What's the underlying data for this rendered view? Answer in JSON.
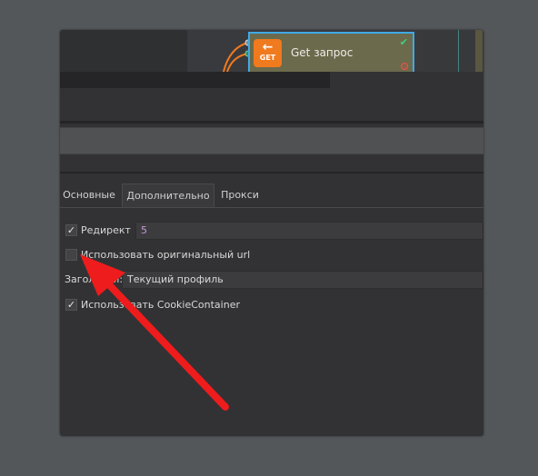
{
  "node": {
    "icon_label": "GET",
    "icon_arrow": "←",
    "title": "Get запрос",
    "status_check": "✔"
  },
  "tabs": [
    {
      "label": "Основные"
    },
    {
      "label": "Дополнительно",
      "active": true
    },
    {
      "label": "Прокси"
    }
  ],
  "settings": {
    "redirect": {
      "label": "Редирект",
      "checked": true,
      "check_glyph": "✓",
      "value": "5"
    },
    "original_url": {
      "label": "Использовать оригинальный url",
      "checked": false
    },
    "headers": {
      "label": "Заголовки:",
      "value": "Текущий профиль"
    },
    "cookie_container": {
      "label": "Использовать CookieContainer",
      "checked": true,
      "check_glyph": "✓"
    }
  },
  "colors": {
    "annotation_arrow": "#ee1c1c",
    "node_border": "#3fa9e6",
    "get_icon_bg": "#f07a1e",
    "redirect_value": "#c79bd8"
  }
}
